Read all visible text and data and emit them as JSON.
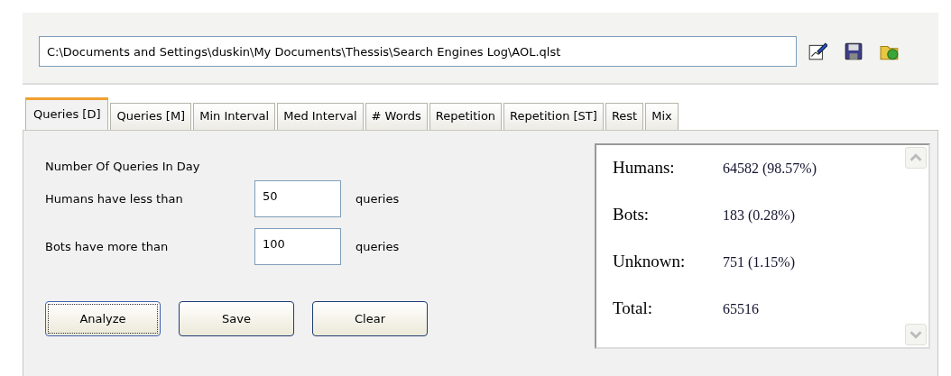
{
  "file_path": {
    "value": "C:\\Documents and Settings\\duskin\\My Documents\\Thessis\\Search Engines Log\\AOL.qlst"
  },
  "toolbar": [
    {
      "kind": "edit"
    },
    {
      "kind": "save"
    },
    {
      "kind": "open"
    }
  ],
  "tabs": [
    {
      "label": "Queries [D]",
      "selected": true
    },
    {
      "label": "Queries [M]",
      "selected": false
    },
    {
      "label": "Min Interval",
      "selected": false
    },
    {
      "label": "Med Interval",
      "selected": false
    },
    {
      "label": "# Words",
      "selected": false
    },
    {
      "label": "Repetition",
      "selected": false
    },
    {
      "label": "Repetition [ST]",
      "selected": false
    },
    {
      "label": "Rest",
      "selected": false
    },
    {
      "label": "Mix",
      "selected": false
    }
  ],
  "section_title": "Number Of Queries In Day",
  "thresholds": [
    {
      "label": "Humans have less than",
      "value": "50",
      "unit": "queries"
    },
    {
      "label": "Bots have more than",
      "value": "100",
      "unit": "queries"
    }
  ],
  "buttons": [
    {
      "label": "Analyze",
      "focused": true
    },
    {
      "label": "Save",
      "focused": false
    },
    {
      "label": "Clear",
      "focused": false
    }
  ],
  "results": [
    {
      "label": "Humans:",
      "value": "64582 (98.57%)"
    },
    {
      "label": "Bots:",
      "value": "183 (0.28%)"
    },
    {
      "label": "Unknown:",
      "value": "751 (1.15%)"
    },
    {
      "label": "Total:",
      "value": "65516"
    }
  ]
}
